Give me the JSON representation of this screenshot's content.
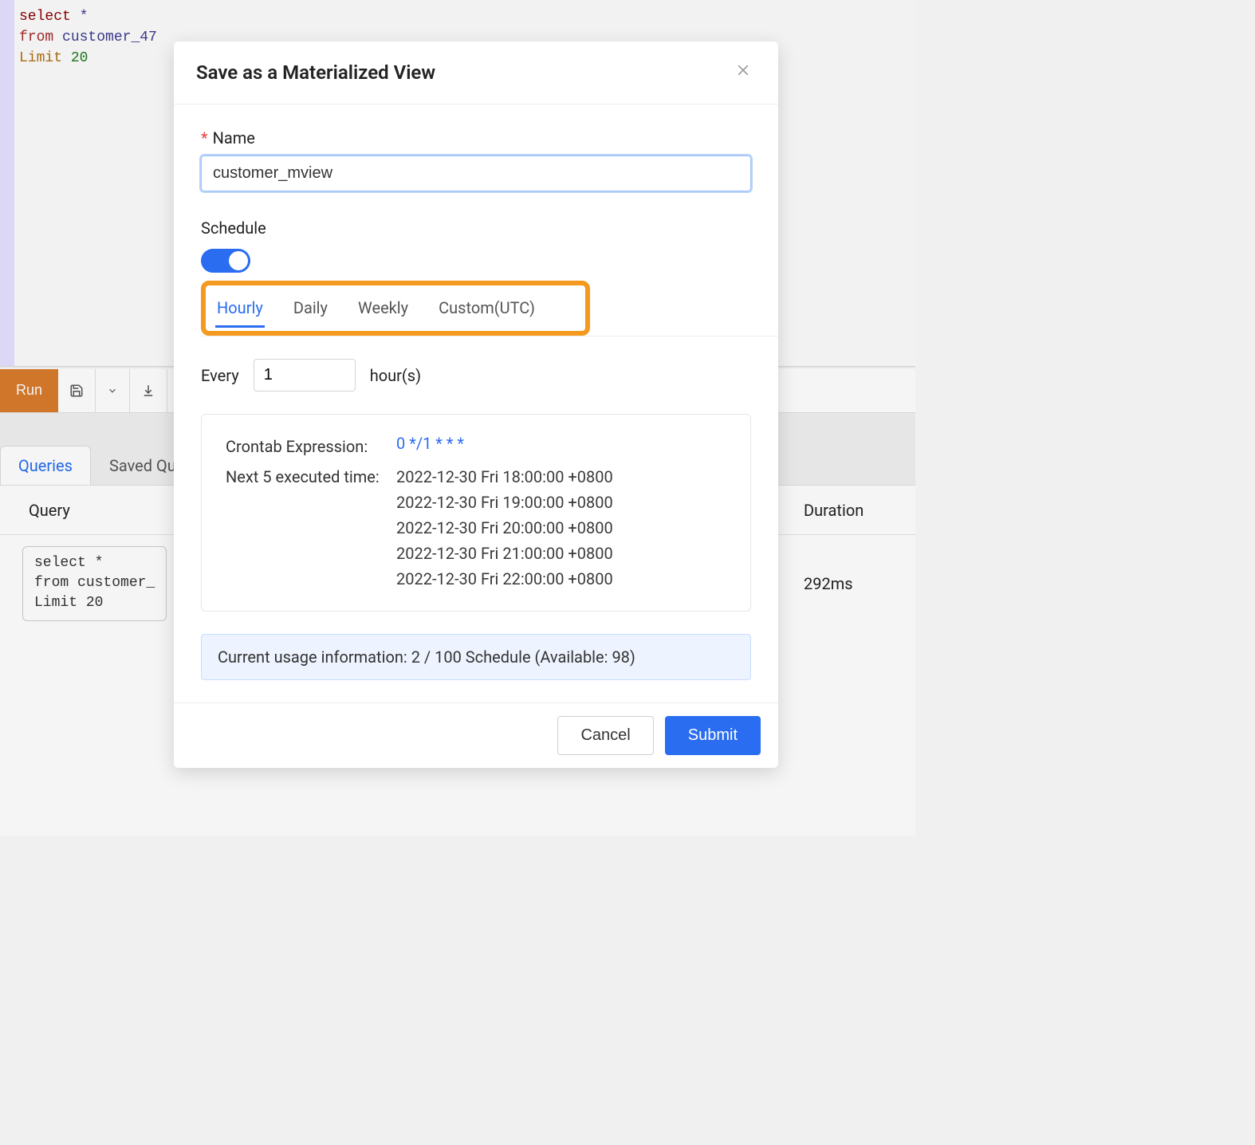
{
  "editor": {
    "code_select": "select",
    "code_star": "*",
    "code_from": "from",
    "code_ident": "customer_47",
    "code_limit": "Limit",
    "code_limit_val": "20"
  },
  "toolbar": {
    "run_label": "Run"
  },
  "tabs": {
    "queries_label": "Queries",
    "saved_label": "Saved Qu"
  },
  "results": {
    "header_query": "Query",
    "header_duration": "Duration",
    "row_code_select": "select",
    "row_code_star": "*",
    "row_code_from": "from",
    "row_code_ident": "customer_",
    "row_code_limit": "Limit",
    "row_code_limit_val": "20",
    "row_duration": "292ms"
  },
  "modal": {
    "title": "Save as a Materialized View",
    "name_label": "Name",
    "name_value": "customer_mview",
    "schedule_label": "Schedule",
    "schedule_enabled": true,
    "tabs": {
      "hourly": "Hourly",
      "daily": "Daily",
      "weekly": "Weekly",
      "custom": "Custom(UTC)"
    },
    "every_label": "Every",
    "every_value": "1",
    "hours_label": "hour(s)",
    "cron_label": "Crontab Expression:",
    "cron_value": "0 */1 * * *",
    "next_exec_label": "Next 5 executed time:",
    "exec_times": [
      "2022-12-30 Fri 18:00:00 +0800",
      "2022-12-30 Fri 19:00:00 +0800",
      "2022-12-30 Fri 20:00:00 +0800",
      "2022-12-30 Fri 21:00:00 +0800",
      "2022-12-30 Fri 22:00:00 +0800"
    ],
    "usage_info": "Current usage information: 2 / 100 Schedule (Available: 98)",
    "cancel_label": "Cancel",
    "submit_label": "Submit"
  }
}
